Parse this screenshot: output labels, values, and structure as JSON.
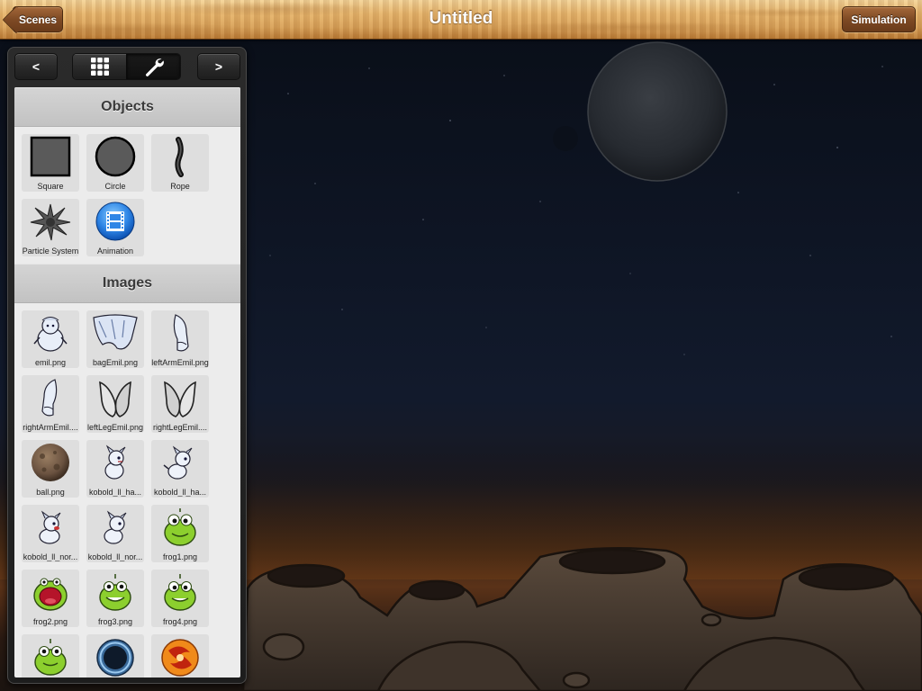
{
  "toolbar": {
    "title": "Untitled",
    "back_label": "Scenes",
    "simulation_label": "Simulation"
  },
  "panel": {
    "prev_label": "<",
    "next_label": ">",
    "segments": [
      {
        "icon": "grid-icon",
        "selected": false
      },
      {
        "icon": "wrench-icon",
        "selected": true
      }
    ],
    "sections": {
      "objects": {
        "title": "Objects",
        "items": [
          {
            "label": "Square",
            "icon": "square-icon"
          },
          {
            "label": "Circle",
            "icon": "circle-icon"
          },
          {
            "label": "Rope",
            "icon": "rope-icon"
          },
          {
            "label": "Particle System",
            "icon": "particle-system-icon"
          },
          {
            "label": "Animation",
            "icon": "animation-film-icon"
          }
        ]
      },
      "images": {
        "title": "Images",
        "items": [
          {
            "label": "emil.png"
          },
          {
            "label": "bagEmil.png"
          },
          {
            "label": "leftArmEmil.png"
          },
          {
            "label": "rightArmEmil...."
          },
          {
            "label": "leftLegEmil.png"
          },
          {
            "label": "rightLegEmil...."
          },
          {
            "label": "ball.png"
          },
          {
            "label": "kobold_ll_ha..."
          },
          {
            "label": "kobold_ll_ha..."
          },
          {
            "label": "kobold_ll_nor..."
          },
          {
            "label": "kobold_ll_nor..."
          },
          {
            "label": "frog1.png"
          },
          {
            "label": "frog2.png"
          },
          {
            "label": "frog3.png"
          },
          {
            "label": "frog4.png"
          },
          {
            "label": ""
          },
          {
            "label": ""
          },
          {
            "label": ""
          }
        ]
      }
    }
  },
  "colors": {
    "wood_light": "#e7b66e",
    "wood_button": "#7e4a24",
    "panel_dark": "#222222",
    "list_bg": "#ececec",
    "night_sky": "#0e1524"
  }
}
